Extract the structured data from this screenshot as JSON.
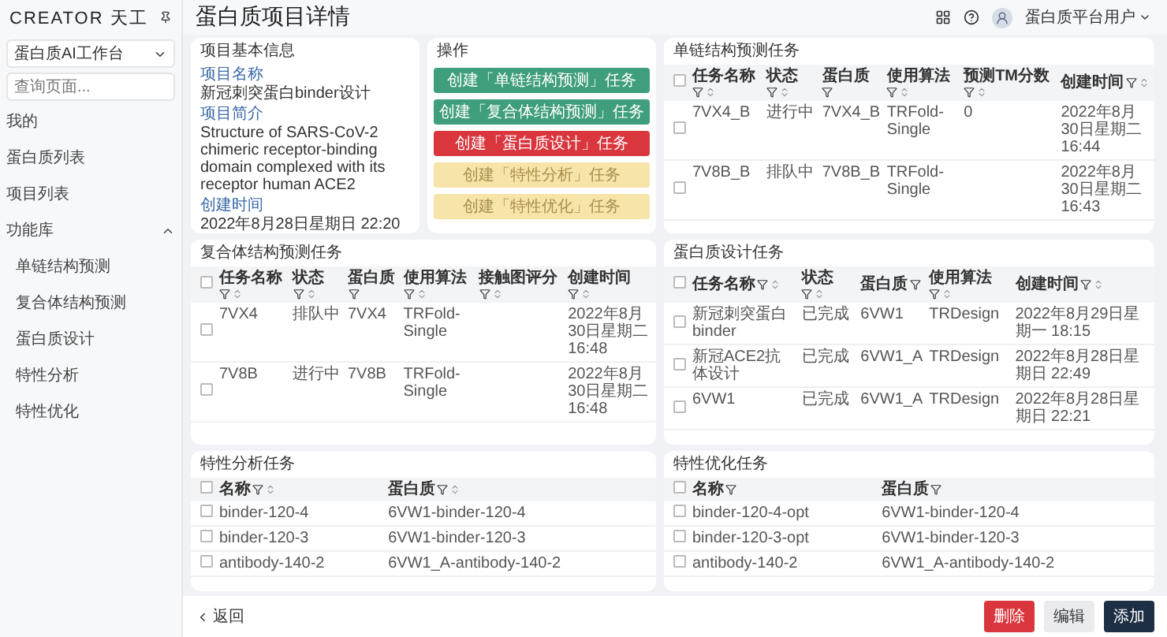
{
  "sidebar": {
    "logo": "CREATOR",
    "logo_suffix": "天工",
    "workspace": "蛋白质AI工作台",
    "search": {
      "placeholder": "查询页面..."
    },
    "items": [
      {
        "label": "我的"
      },
      {
        "label": "蛋白质列表"
      },
      {
        "label": "项目列表"
      },
      {
        "label": "功能库",
        "expanded": true,
        "children": [
          {
            "label": "单链结构预测"
          },
          {
            "label": "复合体结构预测"
          },
          {
            "label": "蛋白质设计"
          },
          {
            "label": "特性分析"
          },
          {
            "label": "特性优化"
          }
        ]
      }
    ]
  },
  "header": {
    "title": "蛋白质项目详情",
    "user": "蛋白质平台用户"
  },
  "basic_info": {
    "title": "项目基本信息",
    "fields": [
      {
        "label": "项目名称",
        "value": "新冠刺突蛋白binder设计"
      },
      {
        "label": "项目简介",
        "value": "Structure of SARS-CoV-2 chimeric receptor-binding domain complexed with its receptor human ACE2"
      },
      {
        "label": "创建时间",
        "value": "2022年8月28日星期日 22:20"
      }
    ]
  },
  "operations": {
    "title": "操作",
    "buttons": [
      {
        "label": "创建「单链结构预测」任务",
        "color": "#3f9e7b",
        "disabled": false
      },
      {
        "label": "创建「复合体结构预测」任务",
        "color": "#3f9e7b",
        "disabled": false
      },
      {
        "label": "创建「蛋白质设计」任务",
        "color": "#d9363e",
        "disabled": false
      },
      {
        "label": "创建「特性分析」任务",
        "color": "#f6e4a8",
        "disabled": true
      },
      {
        "label": "创建「特性优化」任务",
        "color": "#f6e4a8",
        "disabled": true
      }
    ]
  },
  "tables": [
    {
      "title": "单链结构预测任务",
      "all_checked": false,
      "columns": [
        {
          "label": "任务名称",
          "filter": true,
          "sort": true
        },
        {
          "label": "状态",
          "filter": true,
          "sort": true
        },
        {
          "label": "蛋白质",
          "filter": true,
          "sort": false
        },
        {
          "label": "使用算法",
          "filter": true,
          "sort": true
        },
        {
          "label": "预测TM分数",
          "filter": true,
          "sort": true
        },
        {
          "label": "创建时间",
          "filter": true,
          "sort": true
        }
      ],
      "rows": [
        {
          "checked": false,
          "cells": [
            "7VX4_B",
            "进行中",
            "7VX4_B",
            "TRFold-Single",
            "0",
            "2022年8月30日星期二 16:44"
          ]
        },
        {
          "checked": false,
          "cells": [
            "7V8B_B",
            "排队中",
            "7V8B_B",
            "TRFold-Single",
            null,
            "2022年8月30日星期二 16:43"
          ]
        }
      ]
    },
    {
      "title": "复合体结构预测任务",
      "all_checked": false,
      "columns": [
        {
          "label": "任务名称",
          "filter": true,
          "sort": true
        },
        {
          "label": "状态",
          "filter": true,
          "sort": true
        },
        {
          "label": "蛋白质",
          "filter": true,
          "sort": false
        },
        {
          "label": "使用算法",
          "filter": true,
          "sort": true
        },
        {
          "label": "接触图评分",
          "filter": true,
          "sort": true
        },
        {
          "label": "创建时间",
          "filter": true,
          "sort": true
        }
      ],
      "rows": [
        {
          "checked": false,
          "cells": [
            "7VX4",
            "排队中",
            "7VX4",
            "TRFold-Single",
            null,
            "2022年8月30日星期二 16:48"
          ]
        },
        {
          "checked": false,
          "cells": [
            "7V8B",
            "进行中",
            "7V8B",
            "TRFold-Single",
            null,
            "2022年8月30日星期二 16:48"
          ]
        }
      ]
    },
    {
      "title": "蛋白质设计任务",
      "all_checked": false,
      "columns": [
        {
          "label": "任务名称",
          "filter": true,
          "sort": true
        },
        {
          "label": "状态",
          "filter": true,
          "sort": true
        },
        {
          "label": "蛋白质",
          "filter": true,
          "sort": false
        },
        {
          "label": "使用算法",
          "filter": true,
          "sort": true
        },
        {
          "label": "创建时间",
          "filter": true,
          "sort": true
        }
      ],
      "rows": [
        {
          "checked": false,
          "cells": [
            "新冠刺突蛋白binder",
            "已完成",
            "6VW1",
            "TRDesign",
            "2022年8月29日星期一 18:15"
          ]
        },
        {
          "checked": false,
          "cells": [
            "新冠ACE2抗体设计",
            "已完成",
            "6VW1_A",
            "TRDesign",
            "2022年8月28日星期日 22:49"
          ]
        },
        {
          "checked": false,
          "cells": [
            "6VW1",
            "已完成",
            "6VW1_A",
            "TRDesign",
            "2022年8月28日星期日 22:21"
          ]
        }
      ]
    },
    {
      "title": "特性分析任务",
      "all_checked": false,
      "columns": [
        {
          "label": "名称",
          "filter": true,
          "sort": true
        },
        {
          "label": "蛋白质",
          "filter": true,
          "sort": true
        }
      ],
      "rows": [
        {
          "checked": false,
          "cells": [
            "binder-120-4",
            "6VW1-binder-120-4"
          ]
        },
        {
          "checked": false,
          "cells": [
            "binder-120-3",
            "6VW1-binder-120-3"
          ]
        },
        {
          "checked": false,
          "cells": [
            "antibody-140-2",
            "6VW1_A-antibody-140-2"
          ]
        }
      ]
    },
    {
      "title": "特性优化任务",
      "all_checked": false,
      "columns": [
        {
          "label": "名称",
          "filter": true,
          "sort": false
        },
        {
          "label": "蛋白质",
          "filter": true,
          "sort": false
        }
      ],
      "rows": [
        {
          "checked": false,
          "cells": [
            "binder-120-4-opt",
            "6VW1-binder-120-4"
          ]
        },
        {
          "checked": false,
          "cells": [
            "binder-120-3-opt",
            "6VW1-binder-120-3"
          ]
        },
        {
          "checked": false,
          "cells": [
            "antibody-140-2",
            "6VW1_A-antibody-140-2"
          ]
        }
      ]
    }
  ],
  "footer": {
    "back": "返回",
    "buttons": [
      {
        "label": "删除",
        "kind": "danger"
      },
      {
        "label": "编辑",
        "kind": "secondary"
      },
      {
        "label": "添加",
        "kind": "primary"
      }
    ]
  }
}
